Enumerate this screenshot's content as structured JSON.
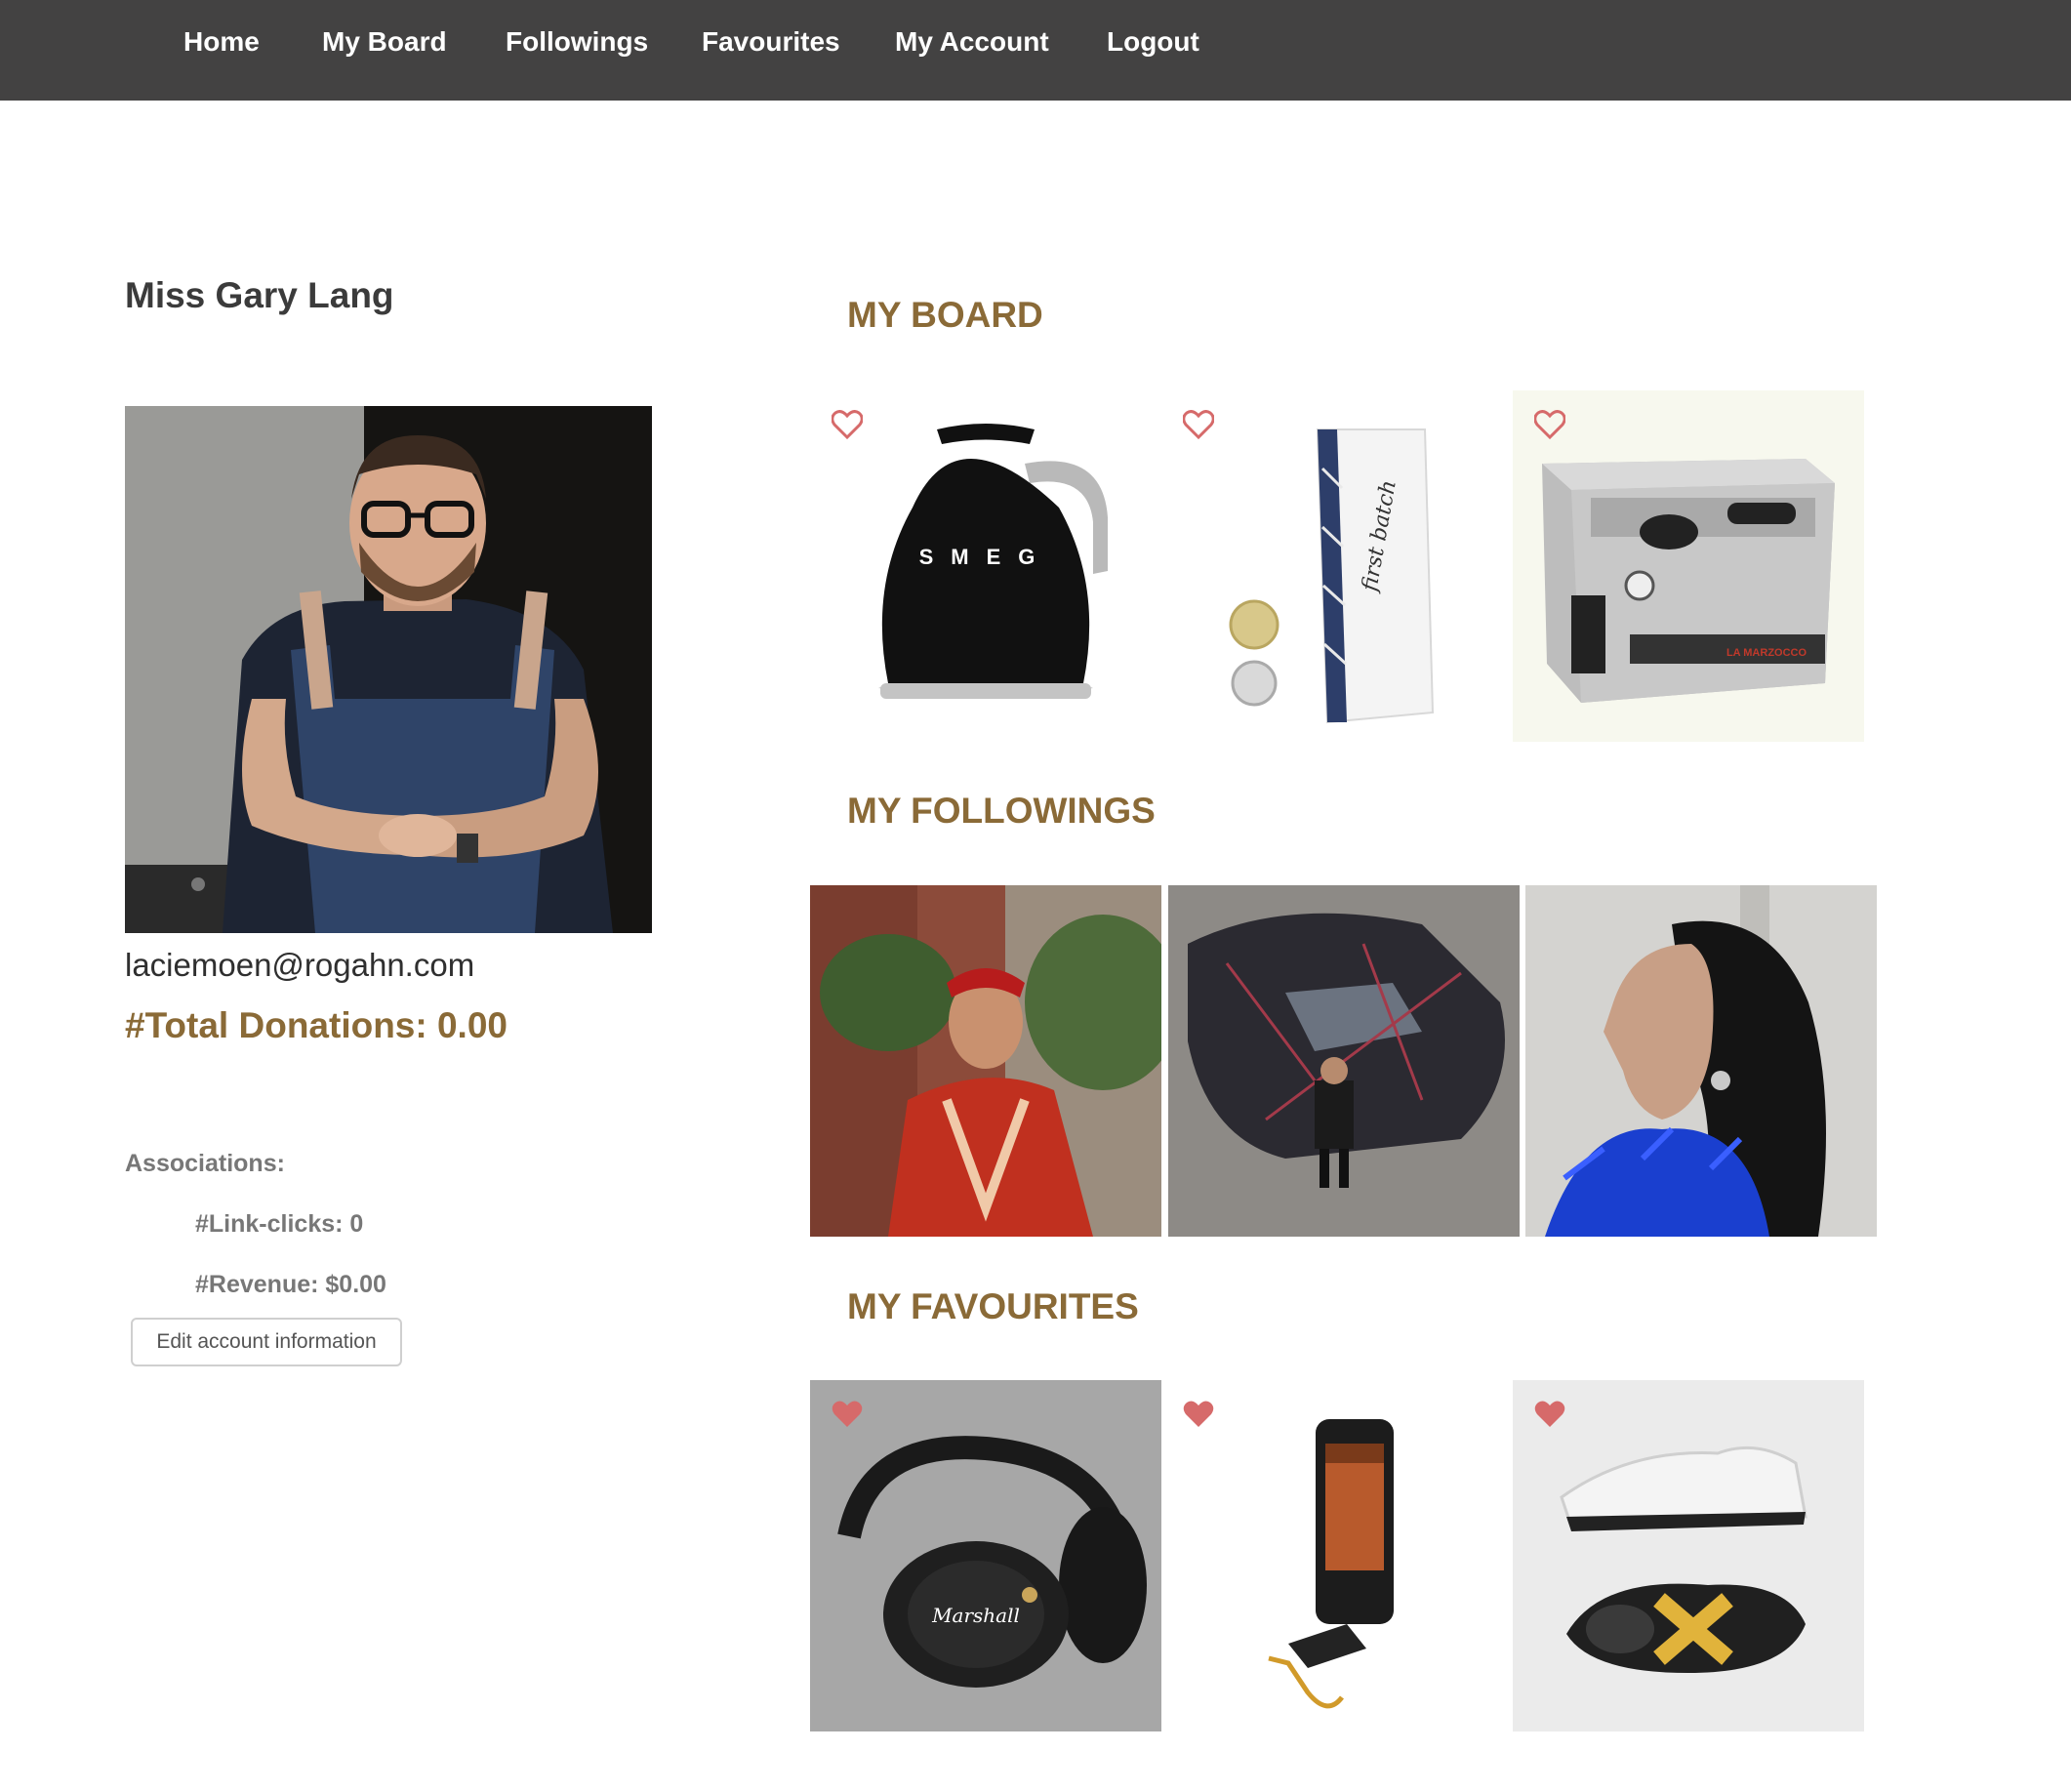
{
  "nav": {
    "items": [
      {
        "label": "Home"
      },
      {
        "label": "My Board"
      },
      {
        "label": "Followings"
      },
      {
        "label": "Favourites"
      },
      {
        "label": "My Account"
      },
      {
        "label": "Logout"
      }
    ]
  },
  "profile": {
    "name": "Miss Gary Lang",
    "email": "laciemoen@rogahn.com",
    "donations": "#Total Donations: 0.00",
    "associations_label": "Associations:",
    "link_clicks": "#Link-clicks: 0",
    "revenue": "#Revenue: $0.00",
    "edit_button": "Edit account information"
  },
  "board": {
    "title": "MY BOARD",
    "items": [
      {
        "image": "smeg-kettle",
        "brand_text": "SMEG",
        "favourited": false
      },
      {
        "image": "coffee-bag",
        "brand_text": "first batch",
        "favourited": false
      },
      {
        "image": "espresso-machine",
        "brand_text": "LA MARZOCCO",
        "favourited": false
      }
    ]
  },
  "followings": {
    "title": "MY FOLLOWINGS",
    "items": [
      {
        "image": "man-in-red-shirt"
      },
      {
        "image": "man-with-sports-car"
      },
      {
        "image": "woman-profile-blue-feathers"
      }
    ]
  },
  "favourites": {
    "title": "MY FAVOURITES",
    "items": [
      {
        "image": "headphones",
        "brand_text": "Marshall",
        "favourited": true
      },
      {
        "image": "rugged-phone",
        "favourited": true
      },
      {
        "image": "sneakers",
        "favourited": true
      }
    ]
  },
  "colors": {
    "nav_bg": "#434242",
    "accent": "#8a6a37",
    "heart": "#d66a6a"
  }
}
